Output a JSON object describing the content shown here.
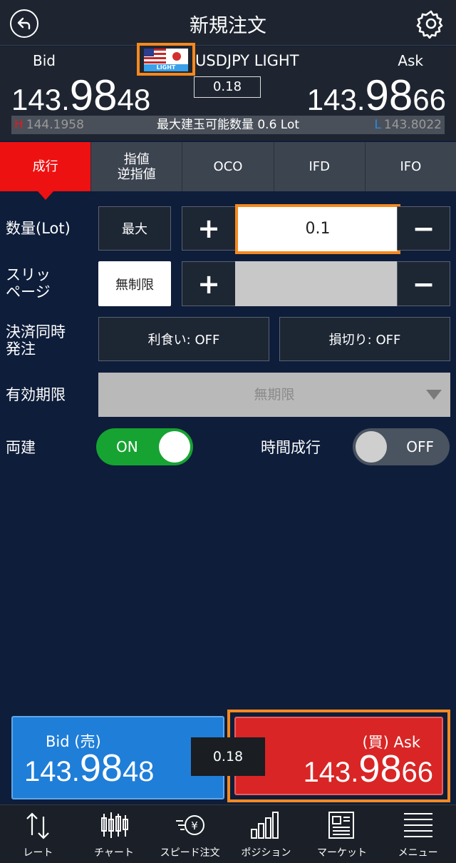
{
  "header": {
    "title": "新規注文"
  },
  "price_header": {
    "bid_label": "Bid",
    "ask_label": "Ask",
    "flag_badge": "LIGHT",
    "symbol": "USDJPY LIGHT",
    "spread": "0.18",
    "bid": {
      "small": "143.",
      "big": "98",
      "tail": "48"
    },
    "ask": {
      "small": "143.",
      "big": "98",
      "tail": "66"
    },
    "high_mark": "H",
    "high": "144.1958",
    "max_qty": "最大建玉可能数量 0.6 Lot",
    "low_mark": "L",
    "low": "143.8022"
  },
  "tabs": [
    {
      "label": "成行",
      "active": true
    },
    {
      "label": "指値\n逆指値",
      "active": false
    },
    {
      "label": "OCO",
      "active": false
    },
    {
      "label": "IFD",
      "active": false
    },
    {
      "label": "IFO",
      "active": false
    }
  ],
  "form": {
    "qty_label": "数量(Lot)",
    "max_button": "最大",
    "qty_value": "0.1",
    "slippage_label_1": "スリッ",
    "slippage_label_2": "ページ",
    "unlimited_button": "無制限",
    "settle_label_1": "決済同時",
    "settle_label_2": "発注",
    "take_profit": "利食い: OFF",
    "stop_loss": "損切り: OFF",
    "expiry_label": "有効期限",
    "expiry_value": "無期限",
    "hedge_label": "両建",
    "hedge_state": "ON",
    "time_market_label": "時間成行",
    "time_market_state": "OFF"
  },
  "trade": {
    "bid_label": "Bid (売)",
    "ask_label": "(買) Ask",
    "bid": {
      "small": "143.",
      "big": "98",
      "tail": "48"
    },
    "ask": {
      "small": "143.",
      "big": "98",
      "tail": "66"
    },
    "spread": "0.18"
  },
  "nav": [
    {
      "label": "レート",
      "icon": "rate-arrows-icon"
    },
    {
      "label": "チャート",
      "icon": "candlestick-chart-icon"
    },
    {
      "label": "スピード注文",
      "icon": "speed-order-icon"
    },
    {
      "label": "ポジション",
      "icon": "position-bars-icon"
    },
    {
      "label": "マーケット",
      "icon": "newspaper-icon"
    },
    {
      "label": "メニュー",
      "icon": "menu-list-icon"
    }
  ],
  "colors": {
    "accent_orange": "#f5891f",
    "tab_active_red": "#ee1111",
    "bid_blue": "#1f7ed8",
    "ask_red": "#d92525",
    "toggle_green": "#16a332",
    "background": "#0e1d3a"
  }
}
